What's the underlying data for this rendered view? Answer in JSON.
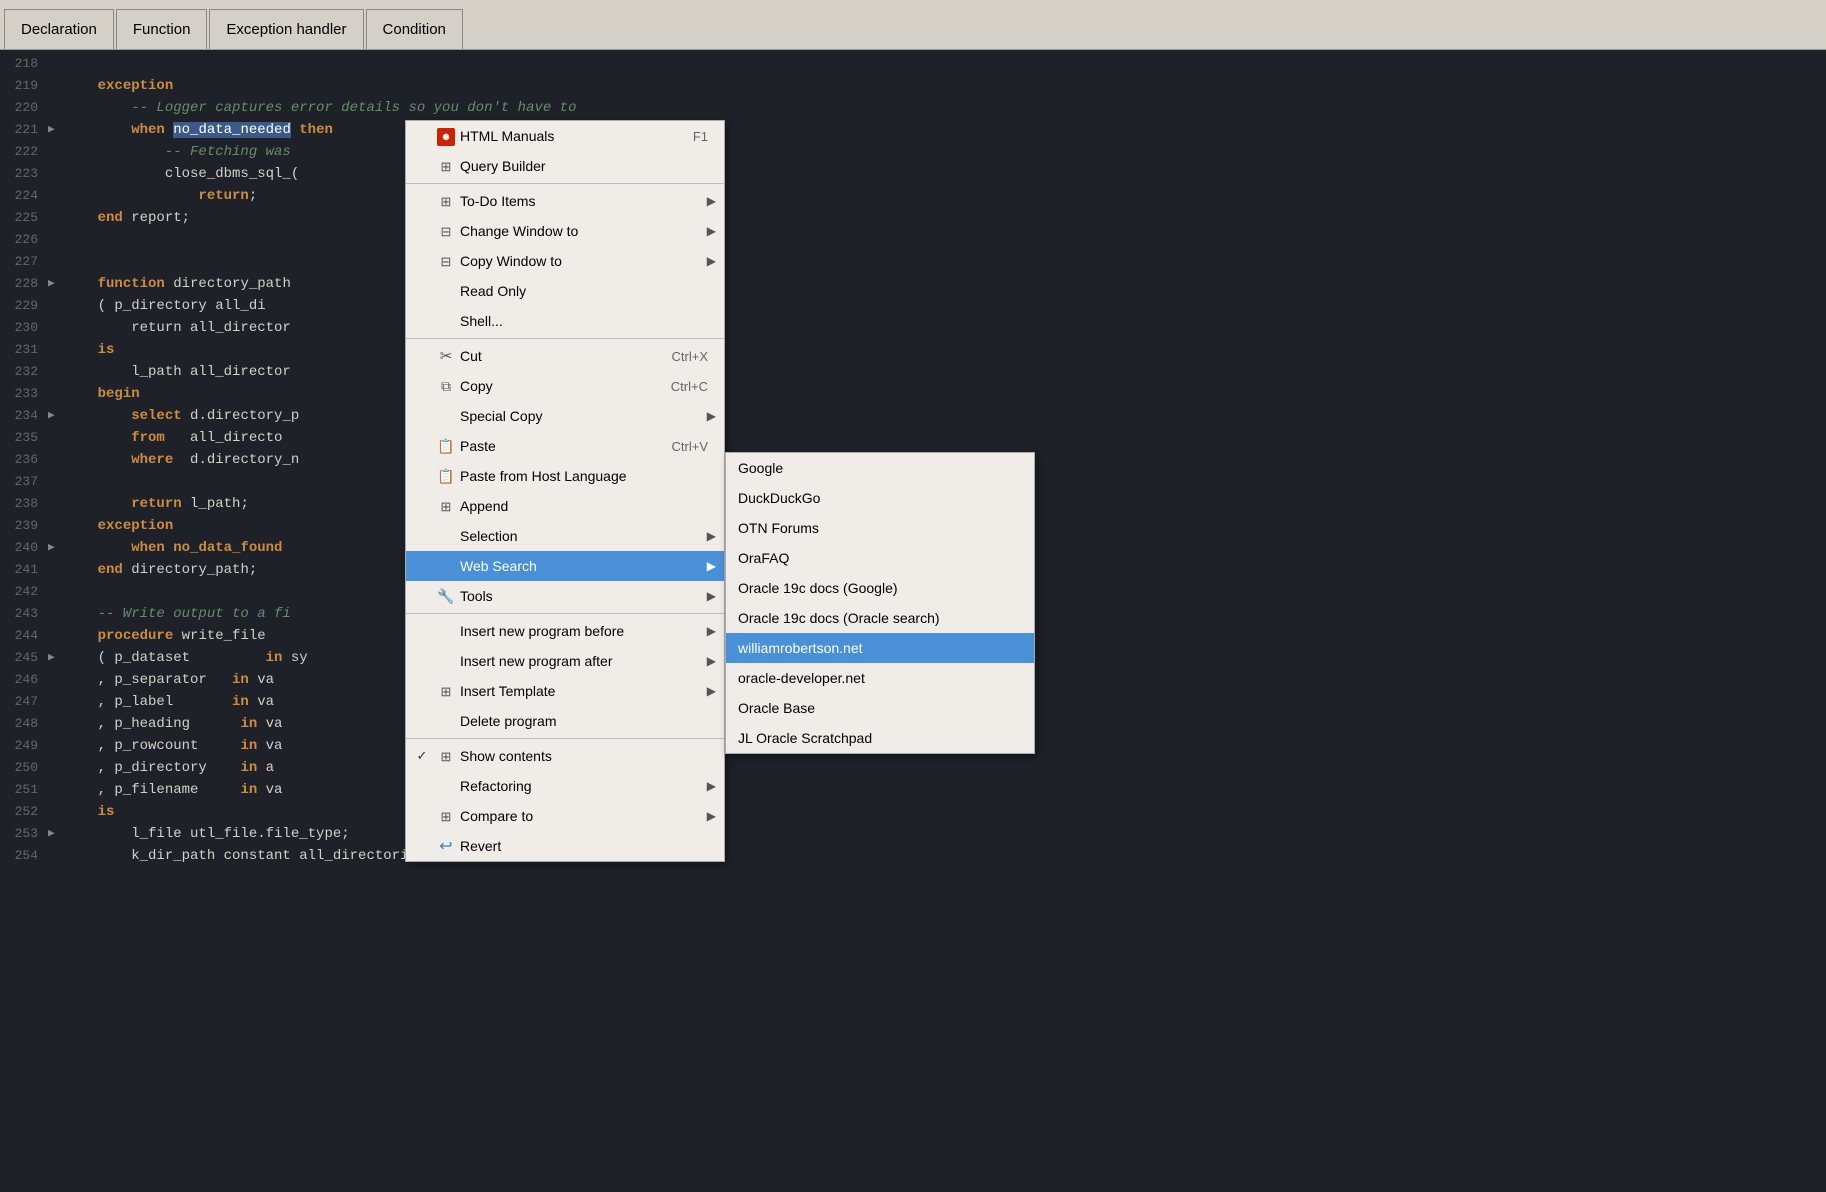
{
  "toolbar": {
    "tabs": [
      {
        "id": "declaration",
        "label": "Declaration"
      },
      {
        "id": "function",
        "label": "Function"
      },
      {
        "id": "exception-handler",
        "label": "Exception handler"
      },
      {
        "id": "condition",
        "label": "Condition"
      }
    ]
  },
  "editor": {
    "lines": [
      {
        "num": "218",
        "arrow": "",
        "content": "",
        "tokens": []
      },
      {
        "num": "219",
        "arrow": "",
        "content": "    exception",
        "type": "keyword-line"
      },
      {
        "num": "220",
        "arrow": "",
        "content": "        -- Logger captures error details so you don't have to",
        "type": "comment-line"
      },
      {
        "num": "221",
        "arrow": "▶",
        "content": "        when no_data_needed then",
        "type": "when-line",
        "highlight": "no_data_needed"
      },
      {
        "num": "222",
        "arrow": "",
        "content": "            -- Fetching was",
        "type": "comment-partial"
      },
      {
        "num": "223",
        "arrow": "",
        "content": "            close_dbms_sql_(",
        "type": "normal-partial"
      },
      {
        "num": "224",
        "arrow": "",
        "content": "                return;",
        "type": "return-line"
      },
      {
        "num": "225",
        "arrow": "",
        "content": "    end report;",
        "type": "end-line"
      },
      {
        "num": "226",
        "arrow": "",
        "content": "",
        "tokens": []
      },
      {
        "num": "227",
        "arrow": "",
        "content": "",
        "tokens": []
      },
      {
        "num": "228",
        "arrow": "▶",
        "content": "    function directory_path",
        "type": "function-line"
      },
      {
        "num": "229",
        "arrow": "",
        "content": "    ( p_directory all_di",
        "type": "normal-partial"
      },
      {
        "num": "230",
        "arrow": "",
        "content": "        return all_director",
        "type": "normal-partial"
      },
      {
        "num": "231",
        "arrow": "",
        "content": "    is",
        "type": "is-line"
      },
      {
        "num": "232",
        "arrow": "",
        "content": "        l_path all_director",
        "type": "normal-partial"
      },
      {
        "num": "233",
        "arrow": "",
        "content": "    begin",
        "type": "begin-line"
      },
      {
        "num": "234",
        "arrow": "▶",
        "content": "        select d.directory_p",
        "type": "select-line"
      },
      {
        "num": "235",
        "arrow": "",
        "content": "        from   all_directo",
        "type": "from-line"
      },
      {
        "num": "236",
        "arrow": "",
        "content": "        where  d.directory_n",
        "type": "where-line"
      },
      {
        "num": "237",
        "arrow": "",
        "content": "",
        "tokens": []
      },
      {
        "num": "238",
        "arrow": "",
        "content": "        return l_path;",
        "type": "return-line"
      },
      {
        "num": "239",
        "arrow": "",
        "content": "    exception",
        "type": "keyword-line"
      },
      {
        "num": "240",
        "arrow": "▶",
        "content": "        when no_data_found",
        "type": "when-line2"
      },
      {
        "num": "241",
        "arrow": "",
        "content": "    end directory_path;",
        "type": "end-line"
      },
      {
        "num": "242",
        "arrow": "",
        "content": "",
        "tokens": []
      },
      {
        "num": "243",
        "arrow": "",
        "content": "    -- Write output to a fi",
        "type": "comment-partial"
      },
      {
        "num": "244",
        "arrow": "",
        "content": "    procedure write_file",
        "type": "proc-line"
      },
      {
        "num": "245",
        "arrow": "▶",
        "content": "    ( p_dataset         in sy",
        "type": "param-line"
      },
      {
        "num": "246",
        "arrow": "",
        "content": "    , p_separator   in va",
        "type": "param-line"
      },
      {
        "num": "247",
        "arrow": "",
        "content": "    , p_label       in va",
        "type": "param-line"
      },
      {
        "num": "248",
        "arrow": "",
        "content": "    , p_heading      in va",
        "type": "param-line"
      },
      {
        "num": "249",
        "arrow": "",
        "content": "    , p_rowcount     in va",
        "type": "param-line"
      },
      {
        "num": "250",
        "arrow": "",
        "content": "    , p_directory    in a",
        "type": "param-line"
      },
      {
        "num": "251",
        "arrow": "",
        "content": "    , p_filename     in va",
        "type": "param-line"
      },
      {
        "num": "252",
        "arrow": "",
        "content": "    is",
        "type": "is-line"
      },
      {
        "num": "253",
        "arrow": "▶",
        "content": "        l_file utl_file.file_type;",
        "type": "normal-line"
      },
      {
        "num": "254",
        "arrow": "",
        "content": "        k_dir_path constant all_directories.directory_path%type",
        "type": "normal-partial"
      }
    ]
  },
  "contextMenu": {
    "items": [
      {
        "id": "html-manuals",
        "icon": "html",
        "label": "HTML Manuals",
        "shortcut": "F1",
        "has_arrow": false
      },
      {
        "id": "query-builder",
        "icon": "query",
        "label": "Query Builder",
        "shortcut": "",
        "has_arrow": false
      },
      {
        "id": "separator1",
        "type": "separator"
      },
      {
        "id": "todo-items",
        "icon": "todo",
        "label": "To-Do Items",
        "shortcut": "",
        "has_arrow": true
      },
      {
        "id": "change-window",
        "icon": "change",
        "label": "Change Window to",
        "shortcut": "",
        "has_arrow": true
      },
      {
        "id": "copy-window",
        "icon": "copy-win",
        "label": "Copy Window to",
        "shortcut": "",
        "has_arrow": true
      },
      {
        "id": "read-only",
        "icon": "",
        "label": "Read Only",
        "shortcut": "",
        "has_arrow": false
      },
      {
        "id": "shell",
        "icon": "",
        "label": "Shell...",
        "shortcut": "",
        "has_arrow": false
      },
      {
        "id": "separator2",
        "type": "separator"
      },
      {
        "id": "cut",
        "icon": "scissors",
        "label": "Cut",
        "shortcut": "Ctrl+X",
        "has_arrow": false
      },
      {
        "id": "copy",
        "icon": "copy",
        "label": "Copy",
        "shortcut": "Ctrl+C",
        "has_arrow": false
      },
      {
        "id": "special-copy",
        "icon": "",
        "label": "Special Copy",
        "shortcut": "",
        "has_arrow": true
      },
      {
        "id": "paste",
        "icon": "paste",
        "label": "Paste",
        "shortcut": "Ctrl+V",
        "has_arrow": false
      },
      {
        "id": "paste-host",
        "icon": "paste",
        "label": "Paste from Host Language",
        "shortcut": "",
        "has_arrow": false
      },
      {
        "id": "append",
        "icon": "append",
        "label": "Append",
        "shortcut": "",
        "has_arrow": false
      },
      {
        "id": "selection",
        "icon": "",
        "label": "Selection",
        "shortcut": "",
        "has_arrow": true
      },
      {
        "id": "web-search",
        "icon": "",
        "label": "Web Search",
        "shortcut": "",
        "has_arrow": true,
        "active": true
      },
      {
        "id": "tools",
        "icon": "tools",
        "label": "Tools",
        "shortcut": "",
        "has_arrow": true
      },
      {
        "id": "separator3",
        "type": "separator"
      },
      {
        "id": "insert-new-before",
        "icon": "",
        "label": "Insert new program before",
        "shortcut": "",
        "has_arrow": true
      },
      {
        "id": "insert-new-after",
        "icon": "",
        "label": "Insert new program after",
        "shortcut": "",
        "has_arrow": true
      },
      {
        "id": "insert-template",
        "icon": "insert",
        "label": "Insert Template",
        "shortcut": "",
        "has_arrow": true
      },
      {
        "id": "delete-program",
        "icon": "",
        "label": "Delete program",
        "shortcut": "",
        "has_arrow": false
      },
      {
        "id": "separator4",
        "type": "separator"
      },
      {
        "id": "show-contents",
        "icon": "show",
        "label": "Show contents",
        "shortcut": "",
        "has_arrow": false,
        "checkmark": "✓"
      },
      {
        "id": "refactoring",
        "icon": "",
        "label": "Refactoring",
        "shortcut": "",
        "has_arrow": true
      },
      {
        "id": "compare-to",
        "icon": "compare",
        "label": "Compare to",
        "shortcut": "",
        "has_arrow": true
      },
      {
        "id": "revert",
        "icon": "revert",
        "label": "Revert",
        "shortcut": "",
        "has_arrow": false
      }
    ]
  },
  "subMenu": {
    "title": "Web Search",
    "items": [
      {
        "id": "google",
        "label": "Google"
      },
      {
        "id": "duckduckgo",
        "label": "DuckDuckGo"
      },
      {
        "id": "otn-forums",
        "label": "OTN Forums"
      },
      {
        "id": "orafaq",
        "label": "OraFAQ"
      },
      {
        "id": "oracle-19c-google",
        "label": "Oracle 19c docs (Google)"
      },
      {
        "id": "oracle-19c-oracle",
        "label": "Oracle 19c docs (Oracle search)"
      },
      {
        "id": "williamrobertson",
        "label": "williamrobertson.net",
        "selected": true
      },
      {
        "id": "oracle-developer",
        "label": "oracle-developer.net"
      },
      {
        "id": "oracle-base",
        "label": "Oracle Base"
      },
      {
        "id": "jl-scratchpad",
        "label": "JL Oracle Scratchpad"
      }
    ]
  },
  "colors": {
    "bg": "#1e2228",
    "menuBg": "#f0ede8",
    "activeMenu": "#4a90d9",
    "keyword": "#cf8c3e",
    "comment": "#6a8a6a",
    "text": "#d4d0c8",
    "lineNum": "#666666",
    "highlight": "#3b5a8a"
  }
}
